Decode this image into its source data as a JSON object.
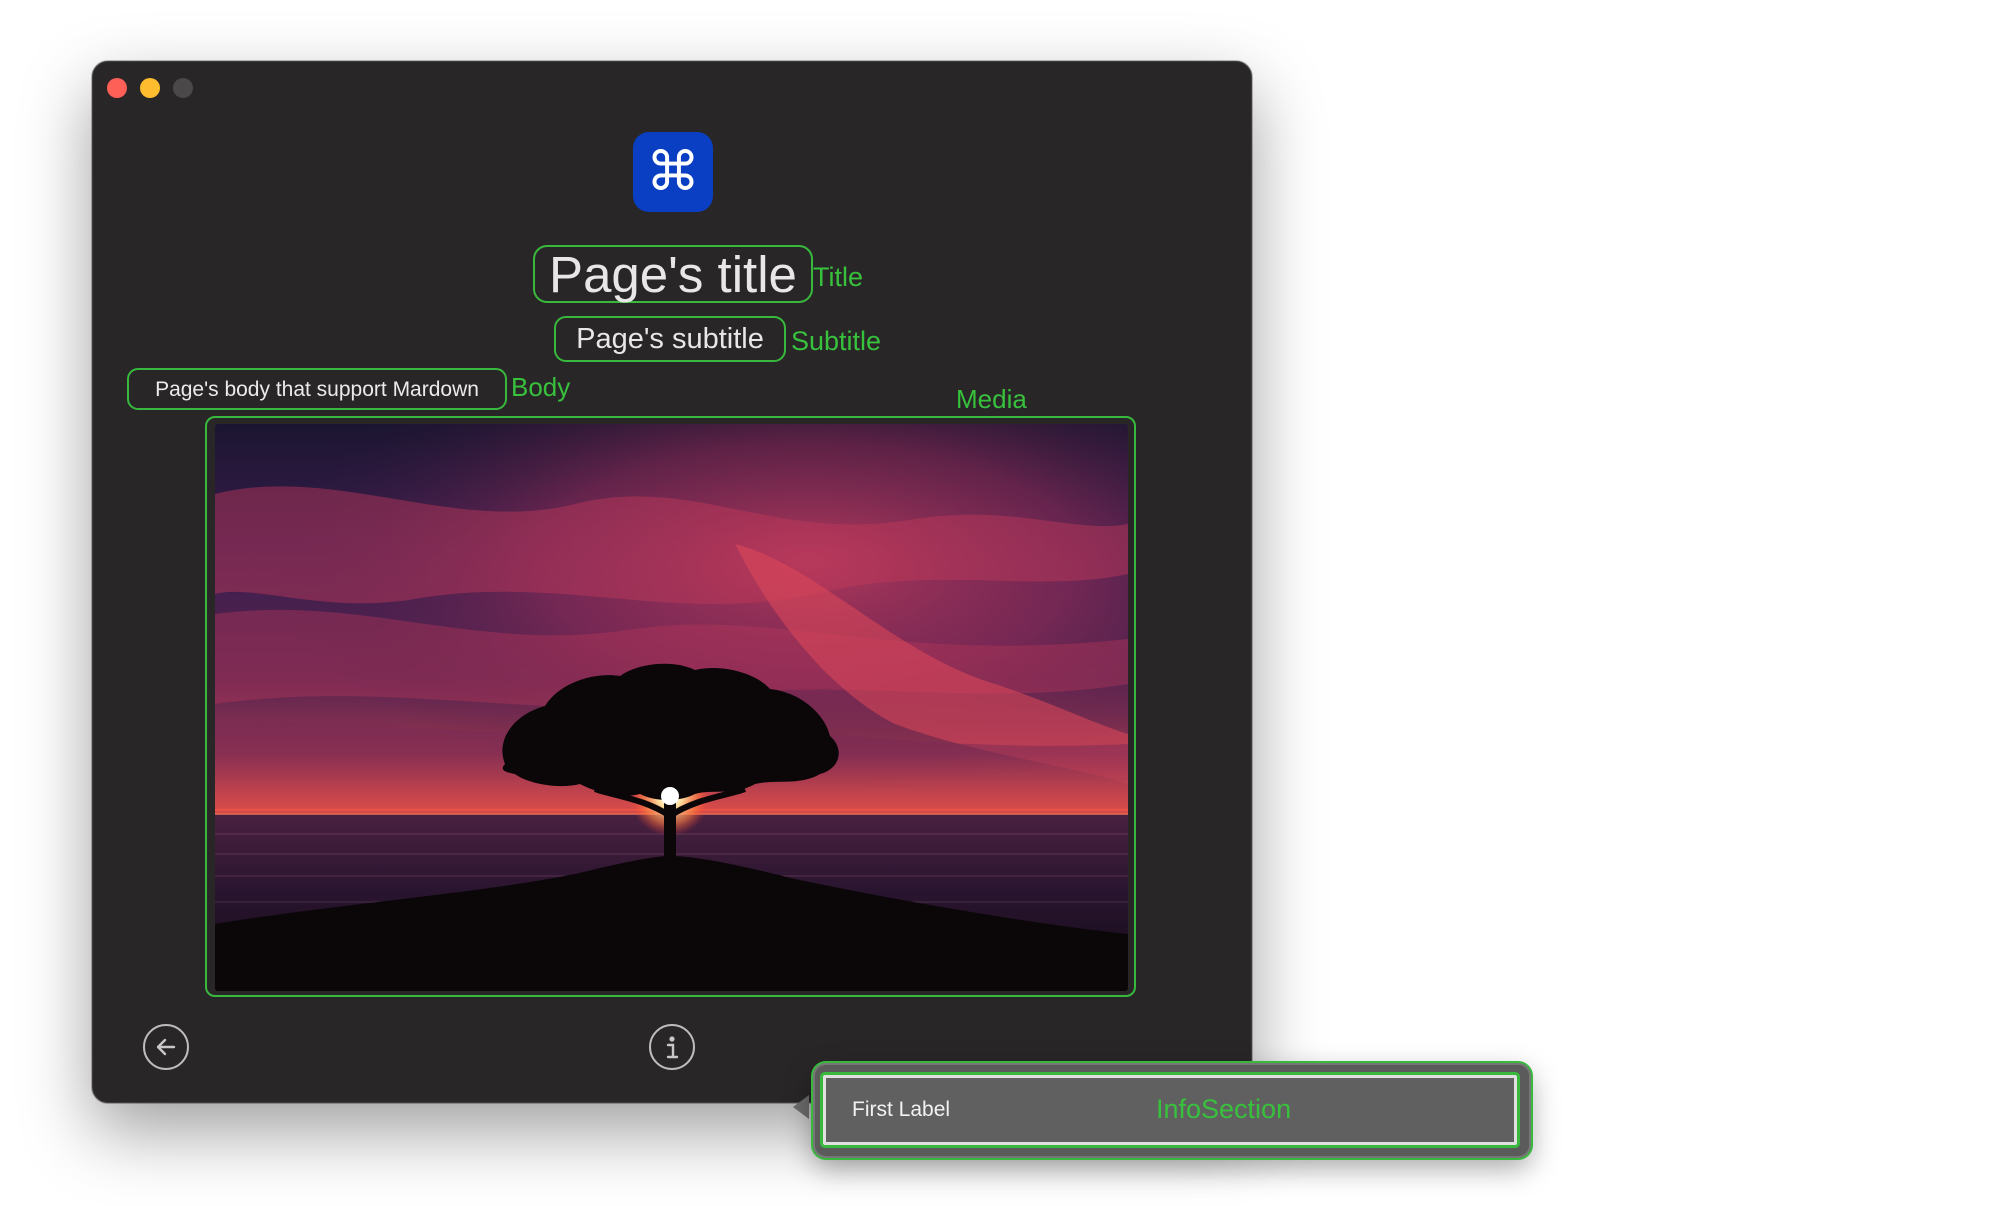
{
  "window": {
    "traffic_lights": [
      "close",
      "minimize",
      "zoom"
    ]
  },
  "app_icon": {
    "glyph": "⌘",
    "color": "#0a3fc4"
  },
  "page": {
    "title": "Page's title",
    "subtitle": "Page's subtitle",
    "body": "Page's body that support Mardown"
  },
  "debug_labels": {
    "title": "Title",
    "subtitle": "Subtitle",
    "body": "Body",
    "media": "Media",
    "info_section": "InfoSection"
  },
  "info_section": {
    "first_label": "First Label"
  },
  "icons": {
    "back": "arrow-left-circle-icon",
    "info": "info-circle-icon"
  },
  "colors": {
    "window_background": "#282627",
    "debug_outline": "#38b93d",
    "popover_background": "#5c5b5c"
  }
}
